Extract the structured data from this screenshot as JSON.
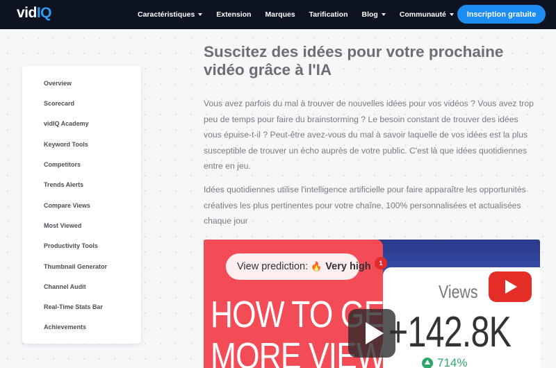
{
  "colors": {
    "nav_bg": "#0d1321",
    "brand_blue": "#1d8cf0",
    "thumb_red": "#f44c56",
    "growth_green": "#2ea76a"
  },
  "header": {
    "logo_vid": "vid",
    "logo_iq": "IQ",
    "nav": [
      {
        "label": "Caractéristiques",
        "has_dropdown": true
      },
      {
        "label": "Extension",
        "has_dropdown": false
      },
      {
        "label": "Marques",
        "has_dropdown": false
      },
      {
        "label": "Tarification",
        "has_dropdown": false
      },
      {
        "label": "Blog",
        "has_dropdown": true
      },
      {
        "label": "Communauté",
        "has_dropdown": true
      }
    ],
    "cta_label": "Inscription gratuite"
  },
  "sidebar": {
    "items": [
      {
        "label": "Overview"
      },
      {
        "label": "Scorecard"
      },
      {
        "label": "vidIQ Academy"
      },
      {
        "label": "Keyword Tools"
      },
      {
        "label": "Competitors"
      },
      {
        "label": "Trends Alerts"
      },
      {
        "label": "Compare Views"
      },
      {
        "label": "Most Viewed"
      },
      {
        "label": "Productivity Tools"
      },
      {
        "label": "Thumbnail Generator"
      },
      {
        "label": "Channel Audit"
      },
      {
        "label": "Real-Time Stats Bar"
      },
      {
        "label": "Achievements"
      }
    ]
  },
  "main": {
    "title": "Suscitez des idées pour votre prochaine vidéo grâce à l'IA",
    "paragraph1": "Vous avez parfois du mal à trouver de nouvelles idées pour vos vidéos ? Vous avez trop peu de temps pour faire du brainstorming ? Le besoin constant de trouver des idées vous épuise-t-il ? Peut-être avez-vous du mal à savoir laquelle de vos idées est la plus susceptible de trouver un écho auprès de votre public. C'est là que idées quotidiennes entre en jeu.",
    "paragraph2": "Idées quotidiennes utilise l'intelligence artificielle pour faire apparaître les opportunités créatives les plus pertinentes pour votre chaîne, 100% personnalisées et actualisées chaque jour"
  },
  "video": {
    "prediction_label": "View prediction:",
    "prediction_value": "Very high",
    "badge_count": "1",
    "headline_line1": "HOW TO GET",
    "headline_line2": "MORE VIEWS",
    "views_label": "Views",
    "views_count": "+142.8K",
    "growth": "714%",
    "icons": [
      "fire-icon",
      "youtube-icon",
      "up-arrow-icon",
      "play-icon"
    ]
  }
}
